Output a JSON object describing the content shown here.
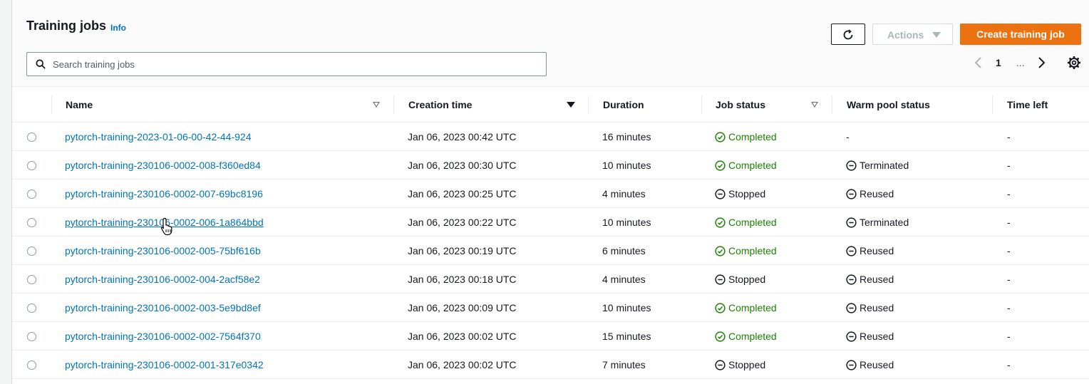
{
  "header": {
    "title": "Training jobs",
    "info_label": "Info",
    "search_placeholder": "Search training jobs",
    "actions_label": "Actions",
    "create_label": "Create training job",
    "pagination": {
      "current_page": "1",
      "ellipsis": "..."
    }
  },
  "columns": {
    "name": "Name",
    "creation_time": "Creation time",
    "duration": "Duration",
    "job_status": "Job status",
    "warm_pool_status": "Warm pool status",
    "time_left": "Time left"
  },
  "rows": [
    {
      "name": "pytorch-training-2023-01-06-00-42-44-924",
      "creation_time": "Jan 06, 2023 00:42 UTC",
      "duration": "16 minutes",
      "job_status": "Completed",
      "warm_pool_status": "-",
      "time_left": "-"
    },
    {
      "name": "pytorch-training-230106-0002-008-f360ed84",
      "creation_time": "Jan 06, 2023 00:30 UTC",
      "duration": "10 minutes",
      "job_status": "Completed",
      "warm_pool_status": "Terminated",
      "time_left": "-"
    },
    {
      "name": "pytorch-training-230106-0002-007-69bc8196",
      "creation_time": "Jan 06, 2023 00:25 UTC",
      "duration": "4 minutes",
      "job_status": "Stopped",
      "warm_pool_status": "Reused",
      "time_left": "-"
    },
    {
      "name": "pytorch-training-230106-0002-006-1a864bbd",
      "creation_time": "Jan 06, 2023 00:22 UTC",
      "duration": "10 minutes",
      "job_status": "Completed",
      "warm_pool_status": "Terminated",
      "time_left": "-"
    },
    {
      "name": "pytorch-training-230106-0002-005-75bf616b",
      "creation_time": "Jan 06, 2023 00:19 UTC",
      "duration": "6 minutes",
      "job_status": "Completed",
      "warm_pool_status": "Reused",
      "time_left": "-"
    },
    {
      "name": "pytorch-training-230106-0002-004-2acf58e2",
      "creation_time": "Jan 06, 2023 00:18 UTC",
      "duration": "4 minutes",
      "job_status": "Stopped",
      "warm_pool_status": "Reused",
      "time_left": "-"
    },
    {
      "name": "pytorch-training-230106-0002-003-5e9bd8ef",
      "creation_time": "Jan 06, 2023 00:09 UTC",
      "duration": "10 minutes",
      "job_status": "Completed",
      "warm_pool_status": "Reused",
      "time_left": "-"
    },
    {
      "name": "pytorch-training-230106-0002-002-7564f370",
      "creation_time": "Jan 06, 2023 00:02 UTC",
      "duration": "15 minutes",
      "job_status": "Completed",
      "warm_pool_status": "Reused",
      "time_left": "-"
    },
    {
      "name": "pytorch-training-230106-0002-001-317e0342",
      "creation_time": "Jan 06, 2023 00:02 UTC",
      "duration": "7 minutes",
      "job_status": "Stopped",
      "warm_pool_status": "Reused",
      "time_left": "-"
    }
  ],
  "colors": {
    "link": "#0073bb",
    "primary_button": "#ec7211",
    "status_completed": "#1d8102"
  }
}
